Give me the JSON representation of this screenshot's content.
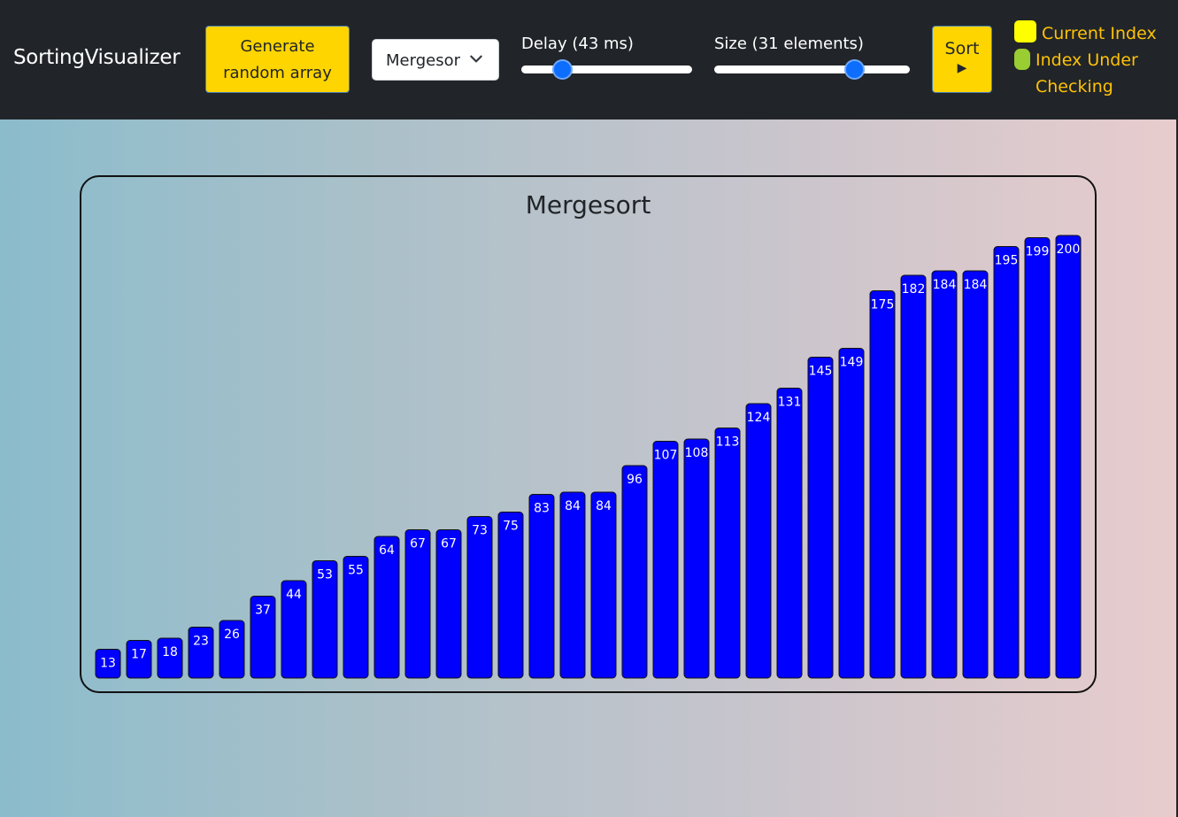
{
  "navbar": {
    "brand": "SortingVisualizer",
    "generate_label_line1": "Generate",
    "generate_label_line2": "random array",
    "algorithm_select": "Mergesort",
    "delay_label": "Delay (43 ms)",
    "delay_value_ms": 43,
    "size_label": "Size (31 elements)",
    "size_value": 31,
    "sort_label": "Sort",
    "sort_icon": "play-icon"
  },
  "legend": {
    "current_index": "Current Index",
    "under_checking_line1": "Index Under",
    "under_checking_line2": "Checking",
    "current_color": "#ffff00",
    "checking_color": "#9acd32"
  },
  "panel": {
    "title": "Mergesort"
  },
  "colors": {
    "bar": "#0000ff",
    "navbar": "#212529",
    "button": "#ffd500",
    "slider_thumb": "#0d6efd"
  },
  "chart_data": {
    "type": "bar",
    "title": "Mergesort",
    "values": [
      13,
      17,
      18,
      23,
      26,
      37,
      44,
      53,
      55,
      64,
      67,
      67,
      73,
      75,
      83,
      84,
      84,
      96,
      107,
      108,
      113,
      124,
      131,
      145,
      149,
      175,
      182,
      184,
      184,
      195,
      199,
      200
    ],
    "ylim": [
      0,
      200
    ],
    "grid": false
  }
}
